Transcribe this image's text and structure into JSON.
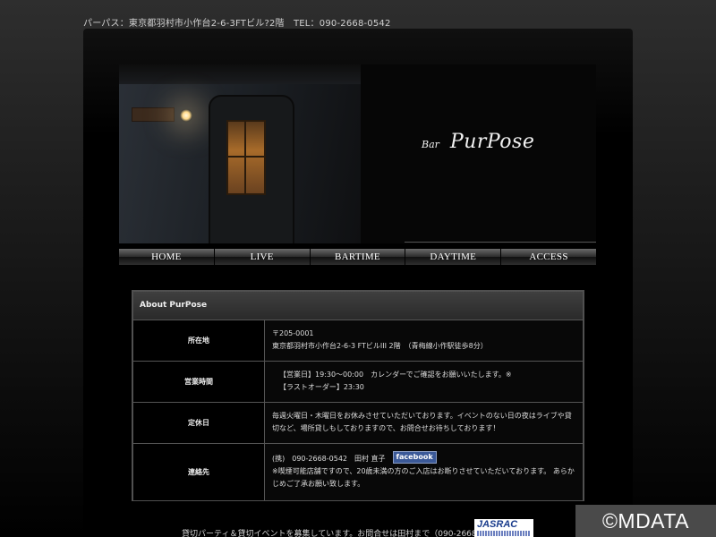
{
  "header": {
    "address_line": "パーパス：東京都羽村市小作台2-6-3FTビル?2階　TEL：090-2668-0542"
  },
  "hero": {
    "logo_prefix": "Bar",
    "logo_name": "PurPose"
  },
  "nav": {
    "items": [
      "HOME",
      "LIVE",
      "BARTIME",
      "DAYTIME",
      "ACCESS"
    ]
  },
  "info": {
    "heading": "About PurPose",
    "rows": [
      {
        "label": "所在地",
        "lines": [
          "〒205-0001",
          "東京都羽村市小作台2-6-3 FTビルIII 2階　（青梅線小作駅徒歩8分）"
        ]
      },
      {
        "label": "営業時間",
        "lines": [
          "【営業日】19:30〜00:00　カレンダーでご確認をお願いいたします。※",
          "【ラストオーダー】23:30"
        ]
      },
      {
        "label": "定休日",
        "lines": [
          "毎週火曜日・木曜日をお休みさせていただいております。イベントのない日の夜はライブや貸",
          "切など、場所貸しもしておりますので、お問合せお待ちしております！"
        ]
      },
      {
        "label": "連絡先",
        "contact": "(携)　090-2668-0542　田村 直子",
        "facebook_label": "facebook",
        "lines": [
          "※喫煙可能店舗ですので、20歳未満の方のご入店はお断りさせていただいております。 あらか",
          "じめご了承お願い致します。"
        ]
      }
    ]
  },
  "footer": {
    "text": "貸切パーティ＆貸切イベントを募集しています。お問合せは田村まで（090-2668-0542）",
    "jasrac_label": "JASRAC"
  },
  "watermark": {
    "text": "©MDATA"
  }
}
